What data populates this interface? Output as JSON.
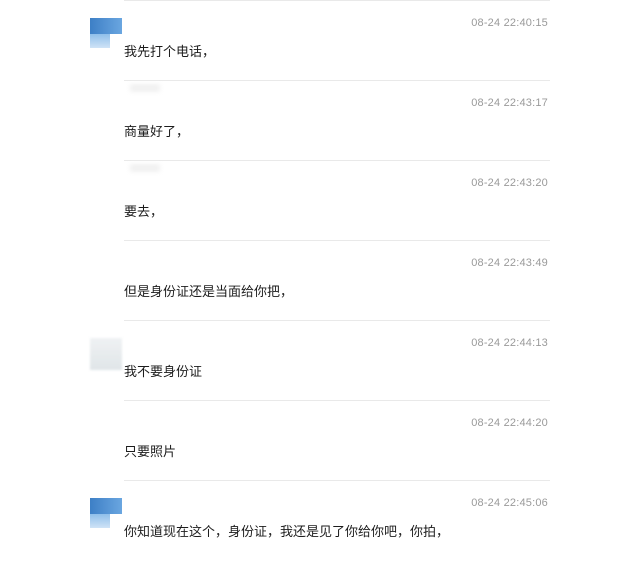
{
  "messages": [
    {
      "time": "08-24 22:40:15",
      "text": "我先打个电话，",
      "avatar": "blue"
    },
    {
      "time": "08-24 22:43:17",
      "text": "商量好了，",
      "avatar": "none"
    },
    {
      "time": "08-24 22:43:20",
      "text": "要去，",
      "avatar": "none"
    },
    {
      "time": "08-24 22:43:49",
      "text": "但是身份证还是当面给你把，",
      "avatar": "none"
    },
    {
      "time": "08-24 22:44:13",
      "text": "我不要身份证",
      "avatar": "blurred"
    },
    {
      "time": "08-24 22:44:20",
      "text": "只要照片",
      "avatar": "none"
    },
    {
      "time": "08-24 22:45:06",
      "text": "你知道现在这个，身份证，我还是见了你给你吧，你拍，",
      "avatar": "blue"
    }
  ],
  "colors": {
    "timestamp": "#9a9a9a",
    "text": "#1c1c1c",
    "divider": "#e9e9e9",
    "avatar_accent": "#3d7fc6"
  }
}
